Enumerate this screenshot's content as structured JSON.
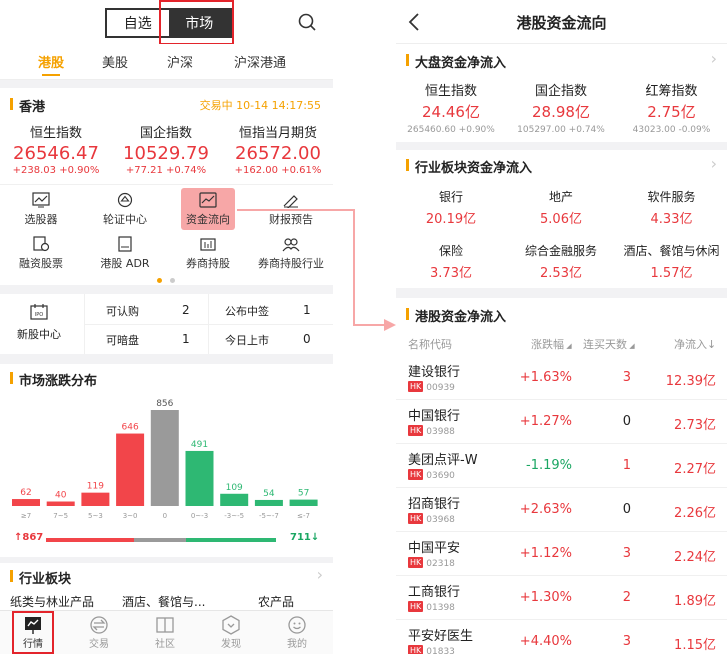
{
  "left": {
    "segment": {
      "watchlist": "自选",
      "market": "市场"
    },
    "market_tabs": [
      "港股",
      "美股",
      "沪深",
      "沪深港通"
    ],
    "hk": {
      "title": "香港",
      "status": "交易中 10-14 14:17:55",
      "indices": [
        {
          "name": "恒生指数",
          "value": "26546.47",
          "change": "+238.03 +0.90%"
        },
        {
          "name": "国企指数",
          "value": "10529.79",
          "change": "+77.21 +0.74%"
        },
        {
          "name": "恒指当月期货",
          "value": "26572.00",
          "change": "+162.00 +0.61%"
        }
      ]
    },
    "tools": [
      {
        "label": "选股器",
        "icon": "chart-screen-icon"
      },
      {
        "label": "轮证中心",
        "icon": "warrant-icon"
      },
      {
        "label": "资金流向",
        "icon": "fund-flow-icon"
      },
      {
        "label": "财报预告",
        "icon": "report-icon"
      },
      {
        "label": "融资股票",
        "icon": "margin-icon"
      },
      {
        "label": "港股 ADR",
        "icon": "adr-icon"
      },
      {
        "label": "券商持股",
        "icon": "broker-icon"
      },
      {
        "label": "券商持股行业",
        "icon": "broker-industry-icon"
      }
    ],
    "ipo": {
      "label": "新股中心",
      "items": [
        {
          "label": "可认购",
          "value": "2"
        },
        {
          "label": "公布中签",
          "value": "1"
        },
        {
          "label": "可暗盘",
          "value": "1"
        },
        {
          "label": "今日上市",
          "value": "0"
        }
      ]
    },
    "distribution": {
      "title": "市场涨跌分布",
      "up_total": "867",
      "down_total": "711",
      "up_arrow": "↑",
      "down_arrow": "↓"
    },
    "chart_data": {
      "type": "bar",
      "categories": [
        "≥7",
        "7~5",
        "5~3",
        "3~0",
        "0",
        "0~-3",
        "-3~-5",
        "-5~-7",
        "≤-7"
      ],
      "values": [
        62,
        40,
        119,
        646,
        856,
        491,
        109,
        54,
        57
      ],
      "colors": [
        "#f2454a",
        "#f2454a",
        "#f2454a",
        "#f2454a",
        "#9a9a9a",
        "#2eb873",
        "#2eb873",
        "#2eb873",
        "#2eb873"
      ],
      "ylim": [
        0,
        856
      ]
    },
    "industry": {
      "title": "行业板块",
      "items": [
        "纸类与林业产品",
        "酒店、餐馆与...",
        "农产品"
      ]
    },
    "nav": [
      {
        "label": "行情",
        "icon": "market-icon"
      },
      {
        "label": "交易",
        "icon": "trade-icon"
      },
      {
        "label": "社区",
        "icon": "community-icon"
      },
      {
        "label": "发现",
        "icon": "discover-icon"
      },
      {
        "label": "我的",
        "icon": "profile-icon"
      }
    ]
  },
  "right": {
    "title": "港股资金流向",
    "big": {
      "title": "大盘资金净流入",
      "items": [
        {
          "name": "恒生指数",
          "value": "24.46亿",
          "sub": "265460.60 +0.90%"
        },
        {
          "name": "国企指数",
          "value": "28.98亿",
          "sub": "105297.00 +0.74%"
        },
        {
          "name": "红筹指数",
          "value": "2.75亿",
          "sub": "43023.00 -0.09%"
        }
      ]
    },
    "sector": {
      "title": "行业板块资金净流入",
      "items": [
        {
          "name": "银行",
          "value": "20.19亿"
        },
        {
          "name": "地产",
          "value": "5.06亿"
        },
        {
          "name": "软件服务",
          "value": "4.33亿"
        },
        {
          "name": "保险",
          "value": "3.73亿"
        },
        {
          "name": "综合金融服务",
          "value": "2.53亿"
        },
        {
          "name": "酒店、餐馆与休闲",
          "value": "1.57亿"
        }
      ]
    },
    "list": {
      "title": "港股资金净流入",
      "headers": {
        "name": "名称代码",
        "change": "涨跌幅",
        "days": "连买天数",
        "inflow": "净流入"
      },
      "market_tag": "HK",
      "rows": [
        {
          "name": "建设银行",
          "code": "00939",
          "change": "+1.63%",
          "days": "3",
          "inflow": "12.39亿"
        },
        {
          "name": "中国银行",
          "code": "03988",
          "change": "+1.27%",
          "days": "0",
          "inflow": "2.73亿"
        },
        {
          "name": "美团点评-W",
          "code": "03690",
          "change": "-1.19%",
          "days": "1",
          "inflow": "2.27亿"
        },
        {
          "name": "招商银行",
          "code": "03968",
          "change": "+2.63%",
          "days": "0",
          "inflow": "2.26亿"
        },
        {
          "name": "中国平安",
          "code": "02318",
          "change": "+1.12%",
          "days": "3",
          "inflow": "2.24亿"
        },
        {
          "name": "工商银行",
          "code": "01398",
          "change": "+1.30%",
          "days": "2",
          "inflow": "1.89亿"
        },
        {
          "name": "平安好医生",
          "code": "01833",
          "change": "+4.40%",
          "days": "3",
          "inflow": "1.15亿"
        }
      ]
    }
  }
}
